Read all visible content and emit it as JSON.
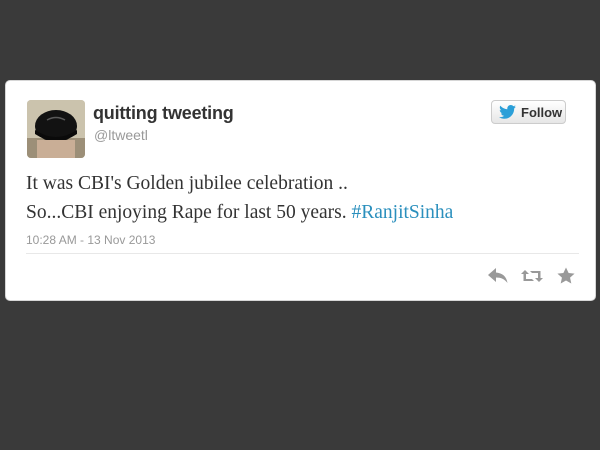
{
  "tweet": {
    "display_name": "quitting tweeting",
    "screen_name": "@ltweetl",
    "follow_label": "Follow",
    "text_line1": "It was CBI's Golden jubilee celebration ..",
    "text_line2": "So...CBI enjoying Rape for last 50 years. ",
    "hashtag": "#RanjitSinha",
    "timestamp": "10:28 AM - 13 Nov 2013"
  },
  "icons": {
    "follow": "twitter-bird-icon",
    "reply": "reply-icon",
    "retweet": "retweet-icon",
    "favorite": "star-icon"
  },
  "colors": {
    "background": "#3a3a3a",
    "card": "#ffffff",
    "link": "#2a8fbd",
    "twitter_blue": "#2b9fd8",
    "action_grey": "#999999"
  }
}
